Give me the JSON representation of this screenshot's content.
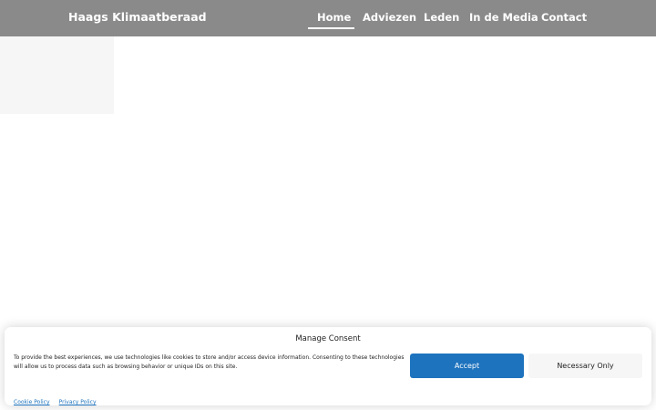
{
  "header": {
    "brand": "Haags Klimaatberaad",
    "nav": [
      {
        "label": "Home",
        "active": true
      },
      {
        "label": "Adviezen",
        "active": false
      },
      {
        "label": "Leden",
        "active": false
      },
      {
        "label": "In de Media",
        "active": false
      },
      {
        "label": "Contact",
        "active": false
      }
    ]
  },
  "consent": {
    "title": "Manage Consent",
    "message": "To provide the best experiences, we use technologies like cookies to store and/or access device information. Consenting to these technologies will allow us to process data such as browsing behavior or unique IDs on this site.",
    "accept_label": "Accept",
    "necessary_label": "Necessary Only",
    "links": [
      "Cookie Policy",
      "Privacy Policy"
    ]
  },
  "colors": {
    "header_bg": "#8a8a8a",
    "accent": "#1e73be",
    "secondary_button_bg": "#f6f6f6"
  }
}
